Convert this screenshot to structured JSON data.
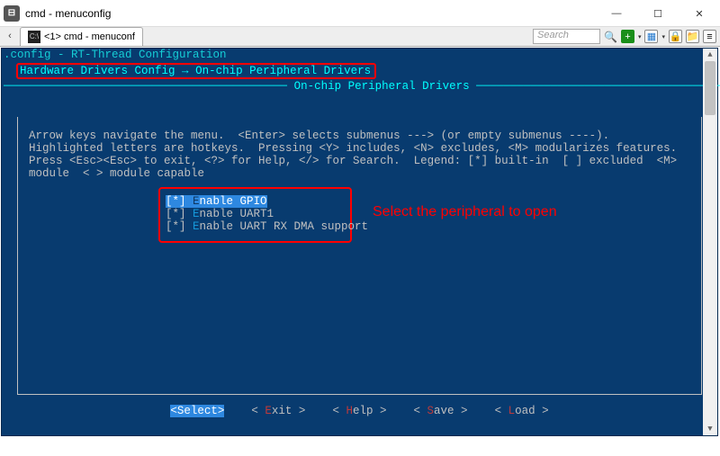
{
  "titlebar": {
    "title": "cmd - menuconfig"
  },
  "tabbar": {
    "tab_number": "<1>",
    "tab_label": "cmd - menuconf",
    "search_placeholder": "Search"
  },
  "terminal": {
    "config_line": ".config - RT-Thread Configuration",
    "breadcrumb_first": "Hardware Drivers Config",
    "breadcrumb_sep": "→",
    "breadcrumb_second": "On-chip Peripheral Drivers",
    "subtitle": "On-chip Peripheral Drivers",
    "help_text": "Arrow keys navigate the menu.  <Enter> selects submenus ---> (or empty submenus ----).  Highlighted letters are hotkeys.  Pressing <Y> includes, <N> excludes, <M> modularizes features.  Press <Esc><Esc> to exit, <?> for Help, </> for Search.  Legend: [*] built-in  [ ] excluded  <M> module  < > module capable"
  },
  "menu": {
    "items": [
      {
        "prefix": "[*] ",
        "hl": "E",
        "rest": "nable GPIO",
        "selected": true
      },
      {
        "prefix": "[*] ",
        "hl": "E",
        "rest": "nable UART1",
        "selected": false
      },
      {
        "prefix": "[*] ",
        "hl": "E",
        "rest": "nable UART RX DMA support",
        "selected": false
      }
    ]
  },
  "annotation": "Select the peripheral to open",
  "buttons": {
    "select": "<Select>",
    "exit_br1": "< ",
    "exit_hl": "E",
    "exit_rest": "xit >",
    "help_br1": "< ",
    "help_hl": "H",
    "help_rest": "elp >",
    "save_br1": "< ",
    "save_hl": "S",
    "save_rest": "ave >",
    "load_br1": "< ",
    "load_hl": "L",
    "load_rest": "oad >"
  },
  "win_controls": {
    "min": "—",
    "max": "☐",
    "close": "✕"
  }
}
